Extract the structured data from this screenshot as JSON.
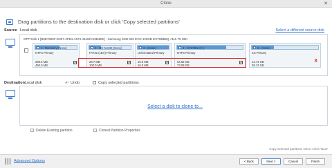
{
  "window": {
    "title": "Clone",
    "close_glyph": "✕"
  },
  "header": {
    "text": "Drag partitions to the destination disk or click 'Copy selected partitions'"
  },
  "source": {
    "label": "Source",
    "value": "Local disk",
    "link": "Select a different source disk",
    "disk_title": "GPT Disk 1 [B6E7605F-E067-4FB4-A974-41102C19B4EE] - Samsung SSD 840 EVO 120GB EXT0BB6Q  <111.79 GB>",
    "disk_sub": "",
    "partitions": [
      {
        "label": "1 - Recovery (None)",
        "type": "NTFS Primary",
        "used": "259.3 MB",
        "total": "450.0 MB",
        "fill": 0.58
      },
      {
        "label": "2 - NO NAME (None)",
        "type": "FAT32 (LBA) Primary",
        "used": "28.7 MB",
        "total": "100.0 MB",
        "fill": 0.29
      },
      {
        "label": "3 - (None)",
        "type": "Unformatted Primary",
        "used": "16.0 MB",
        "total": "16.0 MB",
        "fill": 1.0
      },
      {
        "label": "4 - SYSTEM (C:)",
        "type": "NTFS Primary",
        "used": "54.52 GB",
        "total": "73.09 GB",
        "fill": 0.75
      },
      {
        "label": "5 - (None)",
        "type": "ext Primary",
        "used": "12.74 GB",
        "total": "38.13 GB",
        "fill": 0.33
      }
    ],
    "check_glyph": "✔",
    "x_glyph": "X"
  },
  "destination": {
    "label": "Destination",
    "value": "Local disk",
    "undo": "Undo",
    "undo_glyph": "↶",
    "copy_selected": "Copy selected partitions",
    "link": "Select a disk to clone to..."
  },
  "options": {
    "delete_existing": "Delete Existing partition",
    "cloned_properties": "Cloned Partition Properties"
  },
  "copy_note": "Copy selected partitions when I click 'Next'",
  "footer": {
    "advanced": "Advanced Options",
    "back": "< Back",
    "next": "Next >",
    "cancel": "Cancel",
    "finish": "Finish"
  },
  "colors": {
    "accent": "#2a6fc9",
    "bar_fill": "#5e98d2",
    "selection_border": "#d33333"
  }
}
